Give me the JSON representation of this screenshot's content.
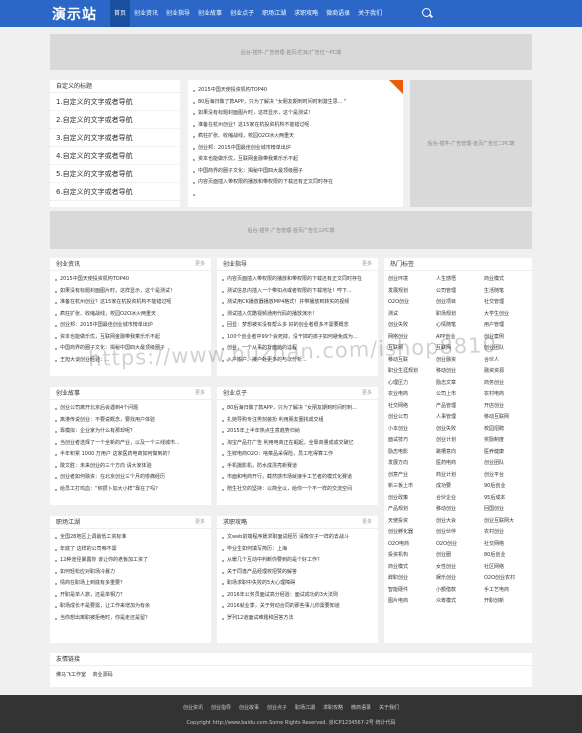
{
  "header": {
    "logo": "演示站",
    "nav": [
      "首页",
      "创业资讯",
      "创业指导",
      "创业故事",
      "创业点子",
      "职场江湖",
      "求职攻略",
      "微商语录",
      "关于我们"
    ]
  },
  "ads": {
    "top": "后台-插件-广告管理-首页/栏目/广告位一PC端",
    "side": "后台-插件-广告管理-首页广告位二PC端",
    "mid": "后台-插件-广告管理-首页广告位三PC端"
  },
  "custom_nav": {
    "title": "自定义的标题",
    "items": [
      "1.自定义的文字或者导航",
      "2.自定义的文字或者导航",
      "3.自定义的文字或者导航",
      "4.自定义的文字或者导航",
      "5.自定义的文字或者导航",
      "6.自定义的文字或者导航"
    ]
  },
  "featured": {
    "items": [
      "2015中国天使投资机构TOP40",
      "80后海归做了款APP，只为了解决 \"女朋友期到时间时刺激生思... \"",
      "如果没有标题封面图片时，这样显示，这个是测试！",
      "准备在杭州创业？这15家在杭投资机构不能错过呢",
      "疯狂扩张、收缩战线，校园O2O冰火两重天",
      "创业邦：2015中国最佳创业城市榜单出炉",
      "资本也能做乐优，互联网金融带我乘乐乐不起",
      "中国商界的圈子文化：揭秘中国四大最顶级圈子",
      "内容页面插入带权限的播放和带权限的下载还有正文同时存在"
    ]
  },
  "sections": [
    {
      "title": "创业资讯",
      "more": "更多",
      "items": [
        "2015中国天使投资机构TOP40",
        "如果没有标题封面图片时，这样显示，这个是测试！",
        "准备在杭州创业？这15家在杭投资机构不能错过呢",
        "疯狂扩张、收缩战线，校园O2O冰火两重天",
        "创业邦：2015中国最佳创业城市榜单出炉",
        "资本也能做乐优，互联网金融带我乘乐乐不起",
        "中国商界的圈子文化：揭秘中国四大最顶级圈子",
        "王旭大谈创业经验：..."
      ]
    },
    {
      "title": "创业指导",
      "more": "更多",
      "items": [
        "内容页面插入带权限的播放和带权限的下载还有正文同时存在",
        "测试信息内插入一个带扣点或者权限的下载地址！哼下...",
        "测试用CK播放器播放MP4格式！并带播放到转实的视频",
        "测试插入优酷视频通用代码的播放演示！",
        "回显：梦想被买没有帮么多 好的创业者很多不需要概念",
        "100个创业者中99个会死掉，没干掉的孩子如何避免成为...",
        "创业，一个从事的背面她的过程",
        "入户搬户、接户处更多的与以分析..."
      ]
    },
    {
      "title": "创业故事",
      "more": "更多",
      "items": [
        "创业公司离开北京后会遇到4个问题",
        "离港传说创业：不要说概念，要找用户体验",
        "靠模拟：企业家为什么有那却呢？",
        "当创业者选择了一个全新的产业，以及一个三线城市...",
        "半年积累 1000 万用户 这家医药电商如何做到的？",
        "敢文胜：未来创业的三个方向 请大家体验",
        "创业者如何融资：在北京创业三个月的惨痛经历",
        "给员工打鸡血：“积攒卜加大小样”靠在了吗？"
      ]
    },
    {
      "title": "创业点子",
      "more": "更多",
      "items": [
        "80后海归做了款APP，只为了解决 “女朋友期到时间时刺...",
        "扎她导购专注男刻装扮 利用朋友圈找成交组",
        "2015年上半年热点生意趋势归纳",
        "淘宝产品打广告 利用电商正在崛起，全靠商量成成交破亿",
        "生鲜电商O2O：啥菜品采保险，员工吃得算工作",
        "手机摄影机，防水成漂亮新赛道",
        "市面和电商开行，截然感市场就接手工艺者的模式化赛道",
        "陪生社交的坚持：以简全以，给你一个不一样的交流空间"
      ]
    },
    {
      "title": "职场江湖",
      "more": "更多",
      "items": [
        "全国28地区上调最低工资标准",
        "年底了 这样的公司咱不需",
        "12种途径暴露你 该让你的老板加工资了",
        "如何轻松应对职场冷暴力",
        "情商在职场上到底有多重要？",
        "开职是单人旅，还是单相力？",
        "职场成长不是要需，让工作来增加为有余",
        "当你想出离职被拒绝时，你是走还是留？"
      ]
    },
    {
      "title": "求职攻略",
      "more": "更多",
      "items": [
        "文web前端程序媛求职面试经历 请像仅子一样的去战斗",
        "毕业生如何填写简历：上海",
        "从暖几个互动中判断你要到的是个好工作?",
        "关于同逢产品经理校招赞的解答",
        "职场求职中失败的5大心理障碍",
        "2016年公务员面试高分经验：面试成功的3大法则",
        "2016就业季，关于劳动合同的那些事儿你需要知道",
        "罗列12道面试难题和回答方法"
      ]
    }
  ],
  "hot_tags": {
    "title": "热门标签",
    "tags": [
      "创业环境",
      "人生感悟",
      "商业模式",
      "发展规划",
      "公司管理",
      "生活随笔",
      "O2O创业",
      "创业项目",
      "社交管理",
      "测试",
      "职场规划",
      "大学生创业",
      "创业失败",
      "心情随笔",
      "用户管理",
      "网络创业",
      "APP创业",
      "创业案例",
      "互联网",
      "互联网",
      "创业团队",
      "移动互联",
      "创业融资",
      "合伙人",
      "职业生涯规划",
      "移动创业",
      "融资资源",
      "心理压力",
      "励志文章",
      "商务创业",
      "农业电商",
      "公司上市",
      "农村电商",
      "社交网络",
      "产品管理",
      "开店创业",
      "创业公司",
      "人事管理",
      "移动互联网",
      "小本创业",
      "创业失败",
      "校园招聘",
      "面试技巧",
      "创业计划",
      "奖励制度",
      "励志电影",
      "跳槽意向",
      "医养健康",
      "发展方向",
      "医药电商",
      "创业团队",
      "创意产业",
      "商业计划",
      "创业平台",
      "新三板上市",
      "成功要",
      "90后创业",
      "创业政策",
      "合伙企业",
      "95后成本",
      "产品规划",
      "移动创业",
      "回国创业",
      "天使投资",
      "创业大会",
      "创业互联网大",
      "创业孵化器",
      "创业伙伴",
      "农村创业",
      "O2O电商",
      "O2O创业",
      "社交网络",
      "投资机构",
      "创业圈",
      "80后创业",
      "商业模式",
      "女性创业",
      "社区网络",
      "辞职创业",
      "娱乐创业",
      "O2O创业农村",
      "智能硬件",
      "小额借款",
      "手工艺电商",
      "图片电商",
      "众筹模式",
      "开职创新"
    ]
  },
  "links": {
    "title": "友情链接",
    "items": [
      "佛马飞工作室",
      "商业源码"
    ]
  },
  "footer": {
    "nav": [
      "创业资讯",
      "创业指导",
      "创业故事",
      "创业点子",
      "职场江湖",
      "求职攻略",
      "微商语录",
      "关于我们"
    ],
    "copyright": "Copyright http://www.baidu.com.Some Rights Reserved. 京ICP1234567-2号 统计代码"
  },
  "watermark": "https://www.huzhan.com/ishop8810"
}
